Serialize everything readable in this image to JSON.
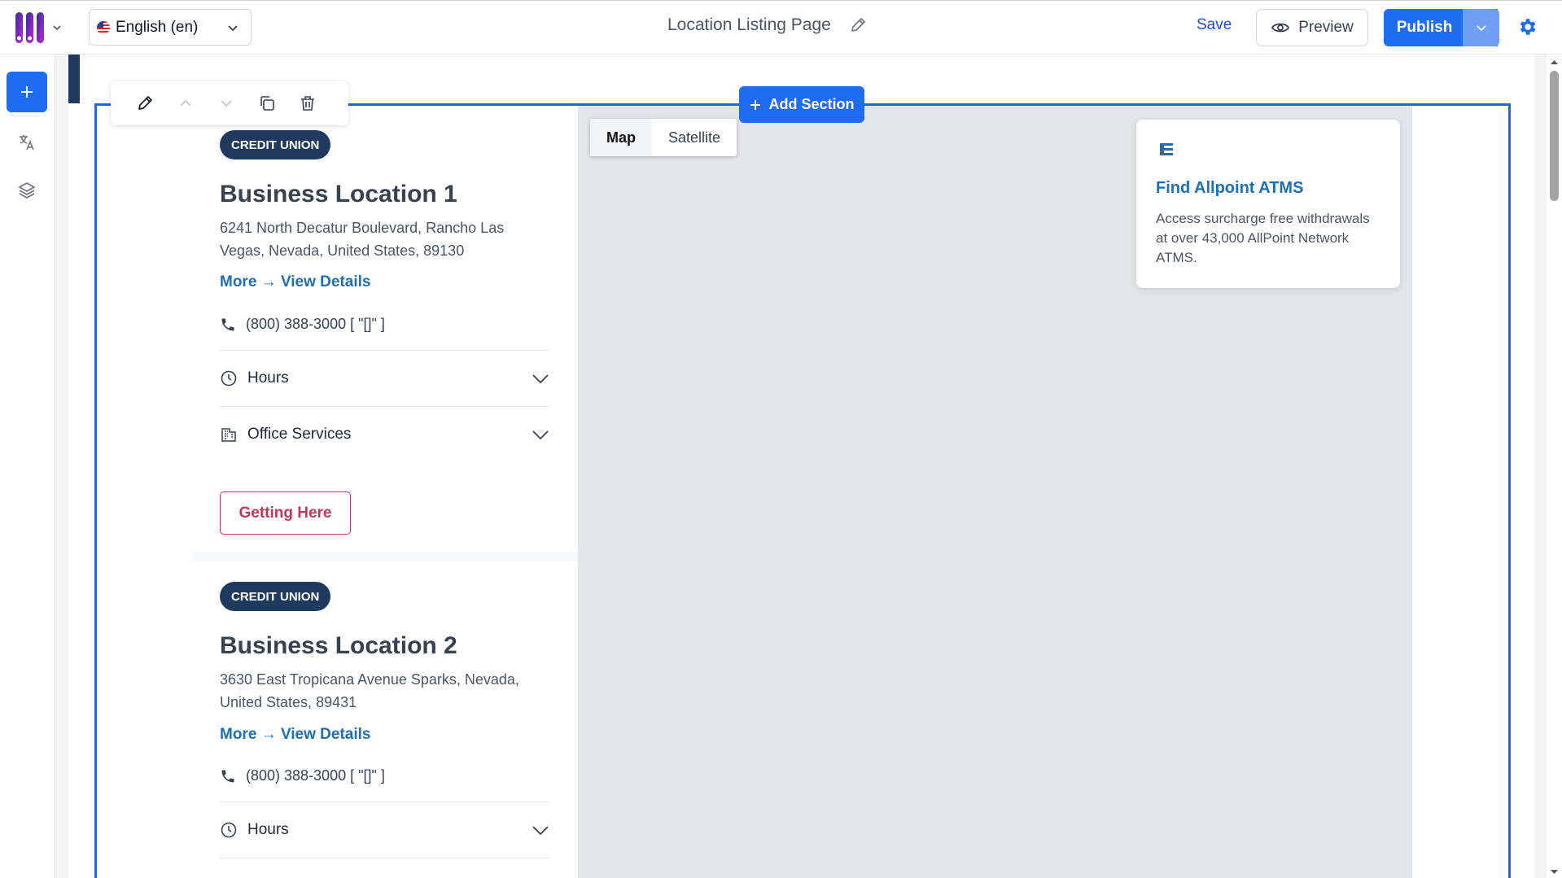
{
  "header": {
    "language": "English (en)",
    "page_title": "Location Listing Page",
    "save_label": "Save",
    "preview_label": "Preview",
    "publish_label": "Publish"
  },
  "editor": {
    "add_section_label": "Add Section"
  },
  "locations": [
    {
      "badge": "CREDIT UNION",
      "name": "Business Location 1",
      "address": "6241 North Decatur Boulevard, Rancho Las Vegas, Nevada, United States, 89130",
      "more_link": "More → View Details",
      "phone": "(800) 388-3000  [ \"[]\" ]",
      "hours_label": "Hours",
      "services_label": "Office Services",
      "getting_here_label": "Getting Here"
    },
    {
      "badge": "CREDIT UNION",
      "name": "Business Location 2",
      "address": "3630 East Tropicana Avenue Sparks, Nevada, United States, 89431",
      "more_link": "More → View Details",
      "phone": "(800) 388-3000  [ \"[]\" ]",
      "hours_label": "Hours"
    }
  ],
  "map": {
    "map_label": "Map",
    "satellite_label": "Satellite"
  },
  "atm_card": {
    "title": "Find Allpoint ATMS",
    "description": "Access surcharge free withdrawals at over 43,000 AllPoint Network ATMS."
  },
  "colors": {
    "accent": "#1e6cf0",
    "badge_bg": "#1e3a5f",
    "link": "#1d6fb8",
    "getting_here": "#c0385a"
  }
}
